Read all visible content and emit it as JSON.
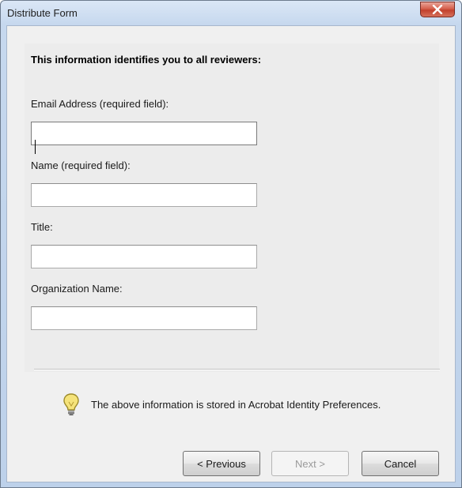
{
  "window": {
    "title": "Distribute Form"
  },
  "form": {
    "heading": "This information identifies you to all reviewers:",
    "fields": [
      {
        "label": "Email Address (required field):",
        "value": "",
        "placeholder": ""
      },
      {
        "label": "Name (required field):",
        "value": "",
        "placeholder": ""
      },
      {
        "label": "Title:",
        "value": "",
        "placeholder": ""
      },
      {
        "label": "Organization Name:",
        "value": "",
        "placeholder": ""
      }
    ]
  },
  "info": {
    "icon": "lightbulb-icon",
    "text": "The above information is stored in Acrobat Identity Preferences."
  },
  "buttons": {
    "previous": "< Previous",
    "next": "Next >",
    "cancel": "Cancel"
  },
  "colors": {
    "close_button": "#c2412c",
    "bulb": "#f5e37a"
  }
}
